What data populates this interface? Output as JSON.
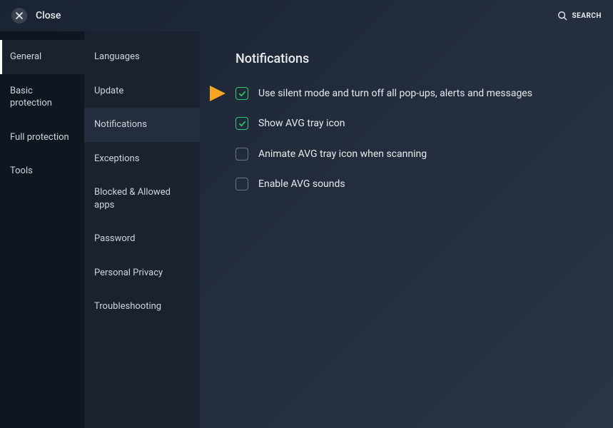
{
  "header": {
    "close_label": "Close",
    "search_label": "SEARCH"
  },
  "sidebar1": {
    "items": [
      {
        "label": "General",
        "active": true
      },
      {
        "label": "Basic protection",
        "active": false
      },
      {
        "label": "Full protection",
        "active": false
      },
      {
        "label": "Tools",
        "active": false
      }
    ]
  },
  "sidebar2": {
    "items": [
      {
        "label": "Languages",
        "active": false
      },
      {
        "label": "Update",
        "active": false
      },
      {
        "label": "Notifications",
        "active": true
      },
      {
        "label": "Exceptions",
        "active": false
      },
      {
        "label": "Blocked & Allowed apps",
        "active": false
      },
      {
        "label": "Password",
        "active": false
      },
      {
        "label": "Personal Privacy",
        "active": false
      },
      {
        "label": "Troubleshooting",
        "active": false
      }
    ]
  },
  "content": {
    "title": "Notifications",
    "options": [
      {
        "label": "Use silent mode and turn off all pop-ups, alerts and messages",
        "checked": true,
        "highlight": true
      },
      {
        "label": "Show AVG tray icon",
        "checked": true,
        "highlight": false
      },
      {
        "label": "Animate AVG tray icon when scanning",
        "checked": false,
        "highlight": false
      },
      {
        "label": "Enable AVG sounds",
        "checked": false,
        "highlight": false
      }
    ]
  }
}
